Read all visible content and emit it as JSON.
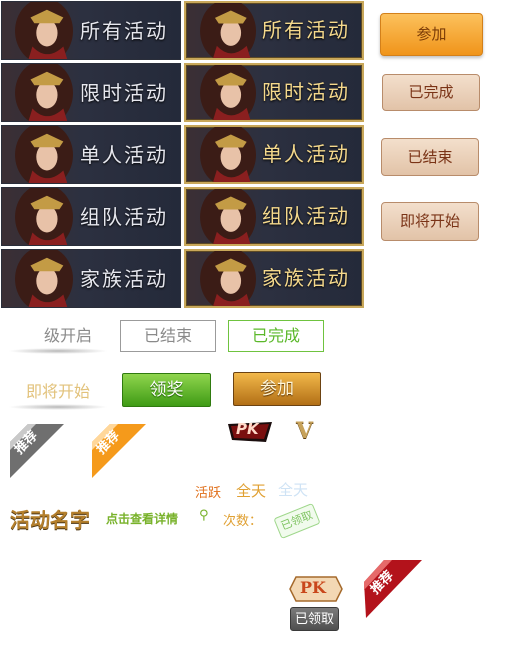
{
  "tiles": [
    {
      "label": "所有活动"
    },
    {
      "label": "限时活动"
    },
    {
      "label": "单人活动"
    },
    {
      "label": "组队活动"
    },
    {
      "label": "家族活动"
    }
  ],
  "right_buttons": {
    "join": "参加",
    "completed": "已完成",
    "ended": "已结束",
    "upcoming": "即将开始"
  },
  "misc": {
    "level_open": "级开启",
    "ended_box": "已结束",
    "completed_box": "已完成",
    "upcoming_gold": "即将开始",
    "claim_button": "领奖",
    "join_button": "参加",
    "pk_badge": "PK",
    "v_badge": "V",
    "recommend_gray": "推荐",
    "recommend_orange": "推荐",
    "recommend_red": "推荐",
    "active_label": "活跃",
    "all_day_orange": "全天",
    "all_day_faint": "全天",
    "activity_name": "活动名字",
    "view_details": "点击查看详情",
    "count_label": "次数：",
    "claimed_stamp": "已领取",
    "pk_tag": "PK",
    "claimed_button": "已领取"
  },
  "colors": {
    "gold_text": "#f5d98c",
    "orange_button": "#f0941a",
    "beige_button": "#e2c3a8",
    "green_button": "#3f9b15",
    "ribbon_red": "#b3121b",
    "ribbon_orange": "#f59a1b"
  }
}
